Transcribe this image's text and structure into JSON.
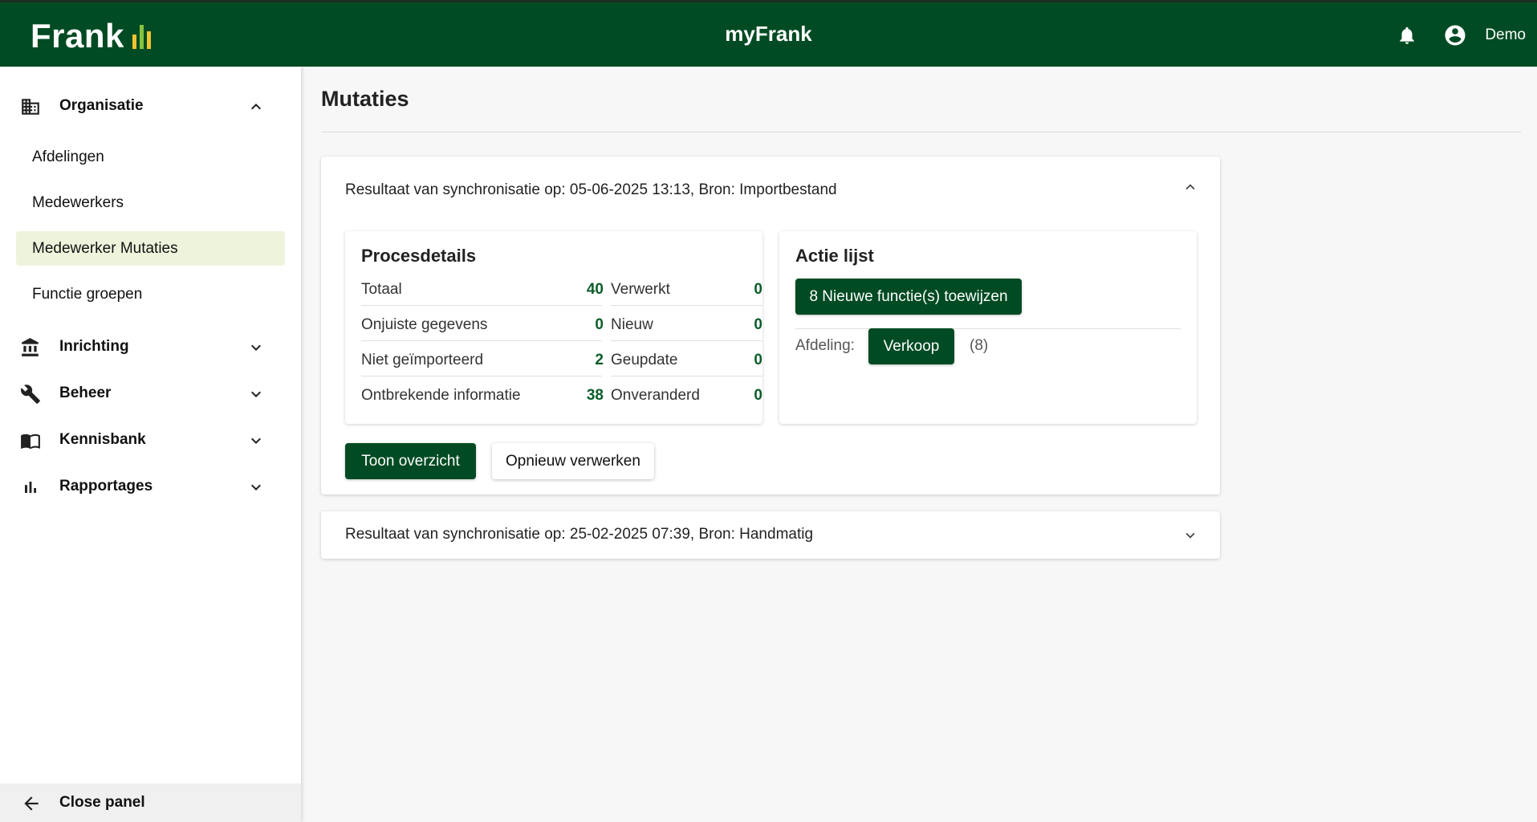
{
  "header": {
    "logo_text": "Frank",
    "app_title": "myFrank",
    "user_name": "Demo",
    "bar_colors": [
      "#f0c330",
      "#86c440",
      "#f0c330"
    ]
  },
  "sidebar": {
    "groups": [
      {
        "label": "Organisatie",
        "icon": "building-icon",
        "expanded": true,
        "items": [
          {
            "label": "Afdelingen"
          },
          {
            "label": "Medewerkers"
          },
          {
            "label": "Medewerker Mutaties",
            "active": true
          },
          {
            "label": "Functie groepen"
          }
        ]
      },
      {
        "label": "Inrichting",
        "icon": "bank-icon",
        "expanded": false
      },
      {
        "label": "Beheer",
        "icon": "wrench-icon",
        "expanded": false
      },
      {
        "label": "Kennisbank",
        "icon": "book-icon",
        "expanded": false
      },
      {
        "label": "Rapportages",
        "icon": "bar-chart-icon",
        "expanded": false
      }
    ],
    "close_label": "Close panel"
  },
  "main": {
    "title": "Mutaties",
    "syncs": [
      {
        "heading": "Resultaat van synchronisatie op: 05-06-2025 13:13, Bron: Importbestand",
        "expanded": true,
        "process": {
          "title": "Procesdetails",
          "left": [
            {
              "label": "Totaal",
              "value": "40"
            },
            {
              "label": "Onjuiste gegevens",
              "value": "0"
            },
            {
              "label": "Niet geïmporteerd",
              "value": "2"
            },
            {
              "label": "Ontbrekende informatie",
              "value": "38"
            }
          ],
          "right": [
            {
              "label": "Verwerkt",
              "value": "0"
            },
            {
              "label": "Nieuw",
              "value": "0"
            },
            {
              "label": "Geupdate",
              "value": "0"
            },
            {
              "label": "Onveranderd",
              "value": "0"
            }
          ]
        },
        "actions": {
          "title": "Actie lijst",
          "assign_button": "8 Nieuwe functie(s) toewijzen",
          "department_label": "Afdeling:",
          "department_button": "Verkoop",
          "department_count": "(8)"
        },
        "show_overview_button": "Toon overzicht",
        "reprocess_button": "Opnieuw verwerken"
      },
      {
        "heading": "Resultaat van synchronisatie op: 25-02-2025 07:39, Bron: Handmatig",
        "expanded": false
      }
    ]
  },
  "colors": {
    "brand_green": "#004b23",
    "value_green": "#0b5d2a",
    "active_bg": "#eef4dc"
  }
}
